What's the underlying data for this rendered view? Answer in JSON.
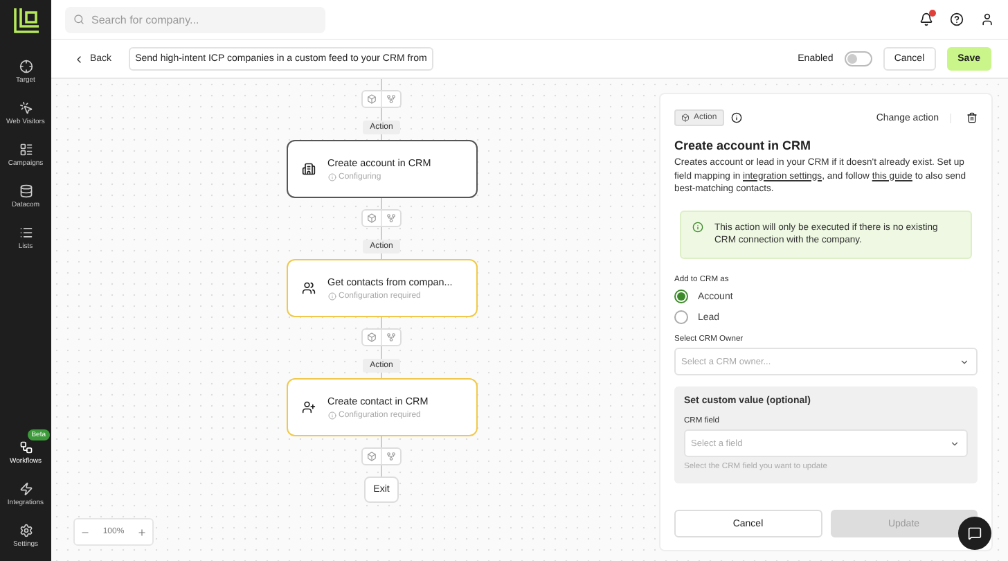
{
  "sidebar": {
    "items": [
      {
        "label": "Target",
        "selected": false
      },
      {
        "label": "Web Visitors",
        "selected": false
      },
      {
        "label": "Campaigns",
        "selected": false
      },
      {
        "label": "Datacom",
        "selected": false
      },
      {
        "label": "Lists",
        "selected": false
      }
    ],
    "bottom_items": [
      {
        "label": "Workflows",
        "selected": true,
        "badge": "Beta"
      },
      {
        "label": "Integrations",
        "selected": false
      },
      {
        "label": "Settings",
        "selected": false
      }
    ]
  },
  "search": {
    "placeholder": "Search for company..."
  },
  "header": {
    "back": "Back",
    "workflow_name": "Send high-intent ICP companies in a custom feed to your CRM from",
    "enabled": {
      "label": "Enabled",
      "on": false
    },
    "cancel": "Cancel",
    "save": "Save"
  },
  "flow": {
    "nodes": [
      {
        "kind": "step",
        "label": "Action",
        "title": "Create account in CRM",
        "status": "Configuring",
        "selected": true
      },
      {
        "kind": "step",
        "label": "Action",
        "title": "Get contacts from compan...",
        "status": "Configuration required",
        "selected": false
      },
      {
        "kind": "step",
        "label": "Action",
        "title": "Create contact in CRM",
        "status": "Configuration required",
        "selected": false
      },
      {
        "kind": "exit",
        "title": "Exit"
      }
    ]
  },
  "zoom": {
    "value": "100%"
  },
  "panel": {
    "tag": "Action",
    "change_action": "Change action",
    "title": "Create account in CRM",
    "description": [
      {
        "kind": "text",
        "text": "Creates account or lead in your CRM if it doesn't already exist. Set up field mapping in "
      },
      {
        "kind": "link",
        "text": "integration settings"
      },
      {
        "kind": "text",
        "text": ", and follow "
      },
      {
        "kind": "link",
        "text": "this guide"
      },
      {
        "kind": "text",
        "text": " to also send best-matching contacts."
      }
    ],
    "notice": "This action will only be executed if there is no existing CRM connection with the company.",
    "add_as": {
      "label": "Add to CRM as",
      "options": [
        {
          "label": "Account",
          "selected": true
        },
        {
          "label": "Lead",
          "selected": false
        }
      ]
    },
    "owner": {
      "label": "Select CRM Owner",
      "placeholder": "Select a CRM owner..."
    },
    "custom": {
      "title": "Set custom value (optional)",
      "field_label": "CRM field",
      "placeholder": "Select a field",
      "hint": "Select the CRM field you want to update"
    },
    "cancel": "Cancel",
    "update": "Update"
  }
}
